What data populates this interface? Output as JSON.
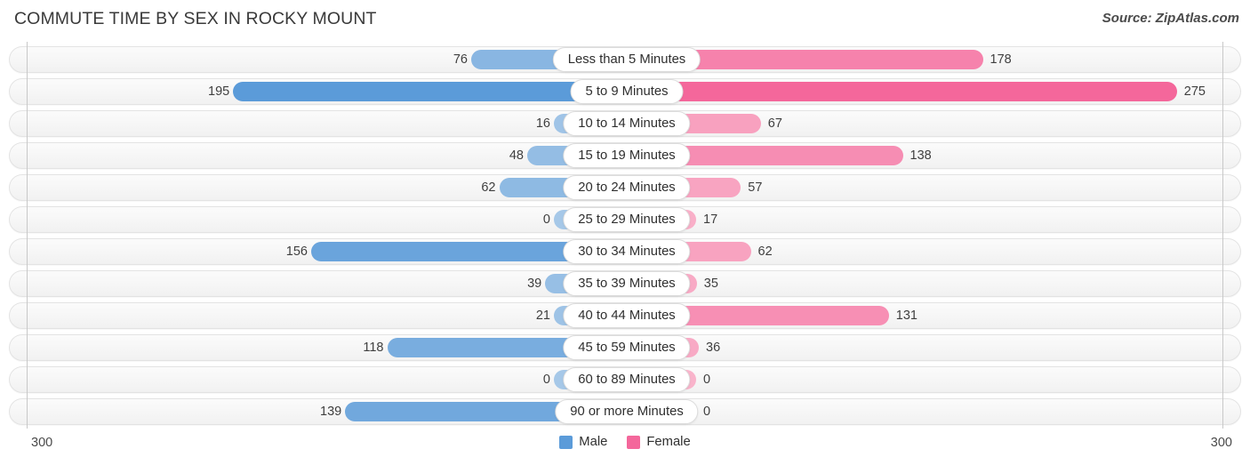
{
  "header": {
    "title": "COMMUTE TIME BY SEX IN ROCKY MOUNT",
    "source": "Source: ZipAtlas.com"
  },
  "legend": {
    "male_label": "Male",
    "female_label": "Female",
    "male_color": "#5b9bd9",
    "female_color": "#f4679b"
  },
  "axis": {
    "left_tick": "300",
    "right_tick": "300"
  },
  "chart_data": {
    "type": "bar",
    "title": "COMMUTE TIME BY SEX IN ROCKY MOUNT",
    "subtitle": "",
    "orientation": "horizontal-diverging",
    "xlabel": "",
    "ylabel": "",
    "xlim": [
      -300,
      300
    ],
    "axis_max": 300,
    "grid": false,
    "legend_position": "bottom-center",
    "categories": [
      "Less than 5 Minutes",
      "5 to 9 Minutes",
      "10 to 14 Minutes",
      "15 to 19 Minutes",
      "20 to 24 Minutes",
      "25 to 29 Minutes",
      "30 to 34 Minutes",
      "35 to 39 Minutes",
      "40 to 44 Minutes",
      "45 to 59 Minutes",
      "60 to 89 Minutes",
      "90 or more Minutes"
    ],
    "series": [
      {
        "name": "Male",
        "color": "#5b9bd9",
        "side": "left",
        "values": [
          76,
          195,
          16,
          48,
          62,
          0,
          156,
          39,
          21,
          118,
          0,
          139
        ]
      },
      {
        "name": "Female",
        "color": "#f4679b",
        "side": "right",
        "values": [
          178,
          275,
          67,
          138,
          57,
          17,
          62,
          35,
          131,
          36,
          0,
          0
        ]
      }
    ]
  }
}
